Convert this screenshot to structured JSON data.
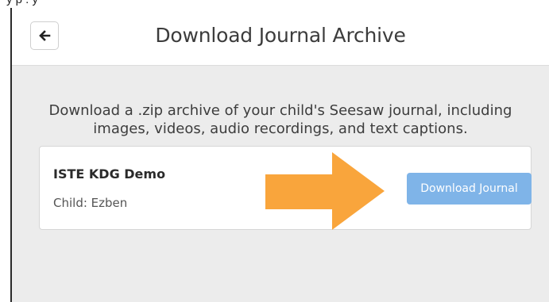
{
  "header": {
    "title": "Download Journal Archive",
    "back_icon": "arrow-left-icon"
  },
  "description": "Download a .zip archive of your child's Seesaw journal, including images, videos, audio recordings, and text captions.",
  "journal_card": {
    "name": "ISTE KDG Demo",
    "child_line": "Child: Ezben",
    "download_label": "Download Journal"
  },
  "colors": {
    "download_button": "#7fb4e8",
    "annotation_arrow": "#f9a53c",
    "background": "#ececec"
  }
}
